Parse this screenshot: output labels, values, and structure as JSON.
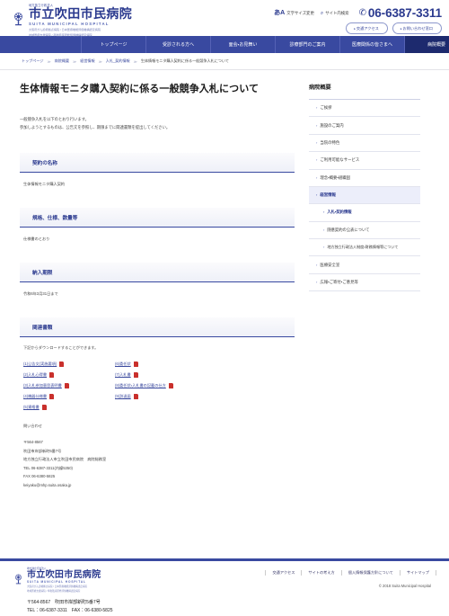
{
  "header": {
    "logo": {
      "corp_line": "地方独立行政法人",
      "name_ja": "市立吹田市民病院",
      "name_en": "SUITA MUNICIPAL HOSPITAL",
      "sub_line1": "大阪府がん診療拠点病院 / 日本医療機能評価機構認定病院",
      "sub_line2": "地域医療支援病院 / 卒後臨床研修評価機構認定病院"
    },
    "utils": {
      "font_size_aa": "あA",
      "font_size_label": "文字サイズ変更",
      "search_icon": "search-icon",
      "search_label": "サイト内検索",
      "tel_icon": "phone-icon",
      "tel": "06-6387-3311"
    },
    "buttons": [
      {
        "label": "交通アクセス"
      },
      {
        "label": "お問い合わせ窓口"
      }
    ]
  },
  "nav": {
    "items": [
      {
        "label": "トップページ",
        "active": false
      },
      {
        "label": "受診される方へ",
        "active": false
      },
      {
        "label": "面会・お見舞い",
        "active": false
      },
      {
        "label": "診療部門のご案内",
        "active": false
      },
      {
        "label": "医療関係の皆さまへ",
        "active": false
      },
      {
        "label": "病院概要",
        "active": true
      }
    ]
  },
  "breadcrumb": {
    "items": [
      "トップページ",
      "病院概要",
      "経営情報",
      "入札_契約情報",
      "生体情報モニタ購入契約に係る一般競争入札について"
    ]
  },
  "main": {
    "title": "生体情報モニタ購入契約に係る一般競争入札について",
    "lead_line1": "一般競争入札を以下のとおり行います。",
    "lead_line2": "参加しようとするものは、公告文を参照し、期限までに関連書類を提出してください。",
    "sections": [
      {
        "heading": "契約の名称",
        "body": "生体情報モニタ購入契約"
      },
      {
        "heading": "規格、仕様、数量等",
        "body": "仕様書のとおり"
      },
      {
        "heading": "納入期限",
        "body": "令和6年3月31日まで"
      }
    ],
    "documents": {
      "heading": "関連書類",
      "note": "下記からダウンロードすることができます。",
      "left": [
        {
          "label": "(1)公告文(実施要項)",
          "icon": "pdf-icon"
        },
        {
          "label": "(2)入札心得書",
          "icon": "pdf-icon"
        },
        {
          "label": "(3)入札参加意思表明書",
          "icon": "pdf-icon"
        },
        {
          "label": "(4)機器仕様書",
          "icon": "pdf-icon"
        },
        {
          "label": "(5)資格書",
          "icon": "pdf-icon"
        }
      ],
      "right": [
        {
          "label": "(6)委任状",
          "icon": "pdf-icon"
        },
        {
          "label": "(7)入札書",
          "icon": "pdf-icon"
        },
        {
          "label": "(8)委任状・入札書の記載の仕方",
          "icon": "pdf-icon"
        },
        {
          "label": "(9)辞退届",
          "icon": "pdf-icon"
        }
      ]
    },
    "contact": {
      "title": "問い合わせ",
      "zip": "〒564-8567",
      "address": "吹田市岸部新町5番7号",
      "org": "地方独立行政法人市立吹田市民病院　病院総務室",
      "tel": "TEL 06-6387-3311(内線5350)",
      "fax": "FAX 06-6380-5825",
      "email": "keiyaku@mhp.suita.osaka.jp"
    }
  },
  "sidebar": {
    "title": "病院概要",
    "items": [
      {
        "label": "ご挨拶",
        "level": 1,
        "selected": false
      },
      {
        "label": "施設のご案内",
        "level": 1,
        "selected": false
      },
      {
        "label": "当院の特色",
        "level": 1,
        "selected": false
      },
      {
        "label": "ご利用可能なサービス",
        "level": 1,
        "selected": false
      },
      {
        "label": "理念・概要・組織図",
        "level": 1,
        "selected": false
      },
      {
        "label": "経営情報",
        "level": 1,
        "selected": true
      },
      {
        "label": "入札・契約情報",
        "level": 2,
        "current": true
      },
      {
        "label": "随意契約の公表について",
        "level": 2,
        "current": false
      },
      {
        "label": "地方独立行政法人制度・財務情報等について",
        "level": 3,
        "current": false
      },
      {
        "label": "医療安全室",
        "level": 1,
        "selected": false
      },
      {
        "label": "広報・ご寄付・ご意見等",
        "level": 1,
        "selected": false
      }
    ]
  },
  "footer": {
    "logo": {
      "corp_line": "地方独立行政法人",
      "name_ja": "市立吹田市民病院",
      "name_en": "SUITA MUNICIPAL HOSPITAL",
      "sub_line1": "大阪府がん診療拠点病院 / 日本医療機能評価機構認定病院",
      "sub_line2": "地域医療支援病院 / 卒後臨床研修評価機構認定病院"
    },
    "address_line": "〒564-8567　吹田市岸部新町5番7号",
    "tel_line": "TEL：06-6387-3311　FAX：06-6380-5825",
    "links": [
      "交通アクセス",
      "サイトの考え方",
      "個人情報保護方針について",
      "サイトマップ"
    ],
    "copyright": "© 2018 Suita Municipal Hospital"
  }
}
